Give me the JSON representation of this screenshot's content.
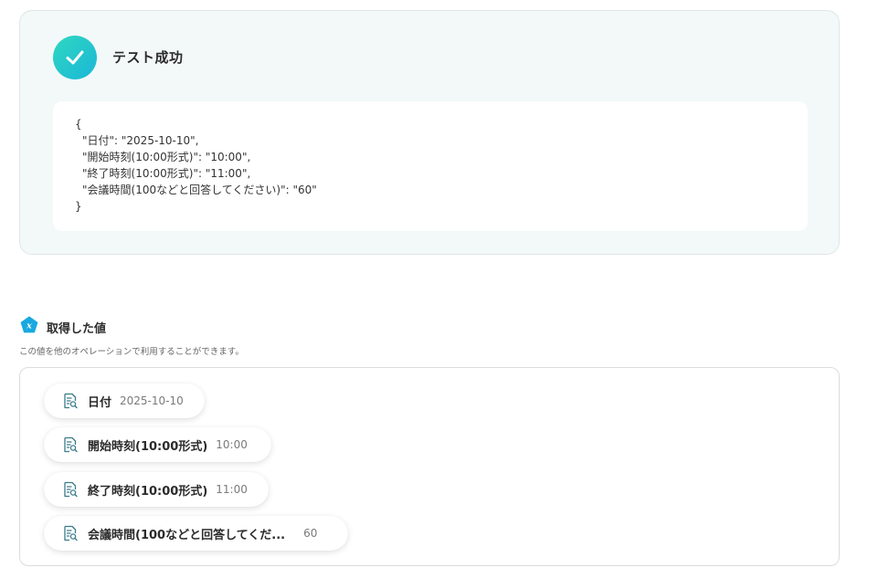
{
  "colors": {
    "accent_teal": "#1bb6d8",
    "success_card_bg": "#f2f9f8",
    "badge_blue": "#19a9e0"
  },
  "test_result": {
    "icon": "check-icon",
    "title": "テスト成功",
    "json_lines": [
      "{",
      "\"日付\": \"2025-10-10\",",
      "\"開始時刻(10:00形式)\": \"10:00\",",
      "\"終了時刻(10:00形式)\": \"11:00\",",
      "\"会議時間(100などと回答してください)\": \"60\"",
      "}"
    ]
  },
  "retrieved_values": {
    "icon": "variable-x-icon",
    "title": "取得した値",
    "description": "この値を他のオペレーションで利用することができます。",
    "items": [
      {
        "icon": "document-search-icon",
        "label": "日付",
        "value": "2025-10-10"
      },
      {
        "icon": "document-search-icon",
        "label": "開始時刻(10:00形式)",
        "value": "10:00"
      },
      {
        "icon": "document-search-icon",
        "label": "終了時刻(10:00形式)",
        "value": "11:00"
      },
      {
        "icon": "document-search-icon",
        "label": "会議時間(100などと回答してくだ...",
        "value": "60"
      }
    ]
  }
}
